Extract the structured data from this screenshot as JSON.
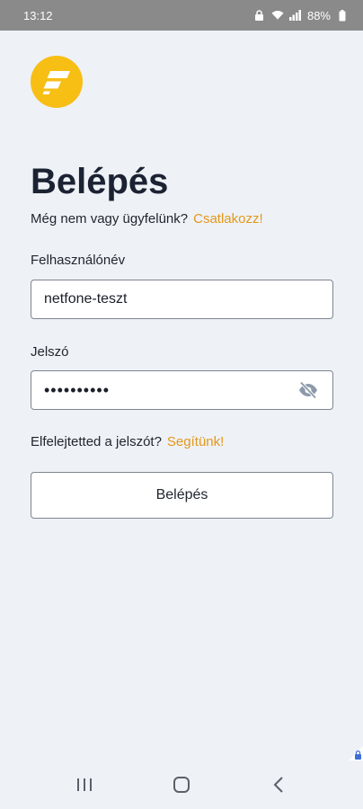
{
  "status_bar": {
    "time": "13:12",
    "battery": "88%",
    "icons": [
      "lock-icon",
      "wifi-icon",
      "signal-icon",
      "battery-icon"
    ]
  },
  "brand": {
    "logo_icon": "brand-logo-icon",
    "accent_color": "#f7be14",
    "link_color": "#e3981a"
  },
  "login": {
    "title": "Belépés",
    "signup_prompt": "Még nem vagy ügyfelünk?",
    "signup_link": "Csatlakozz!",
    "username_label": "Felhasználónév",
    "username_value": "netfone-teszt",
    "password_label": "Jelszó",
    "password_value": "sharedpasw",
    "password_visibility_icon": "eye-off-icon",
    "forgot_prompt": "Elfelejtetted a jelszót?",
    "forgot_link": "Segítünk!",
    "submit_label": "Belépés"
  },
  "nav_bar": {
    "buttons": [
      "recents-icon",
      "home-icon",
      "back-icon"
    ]
  }
}
